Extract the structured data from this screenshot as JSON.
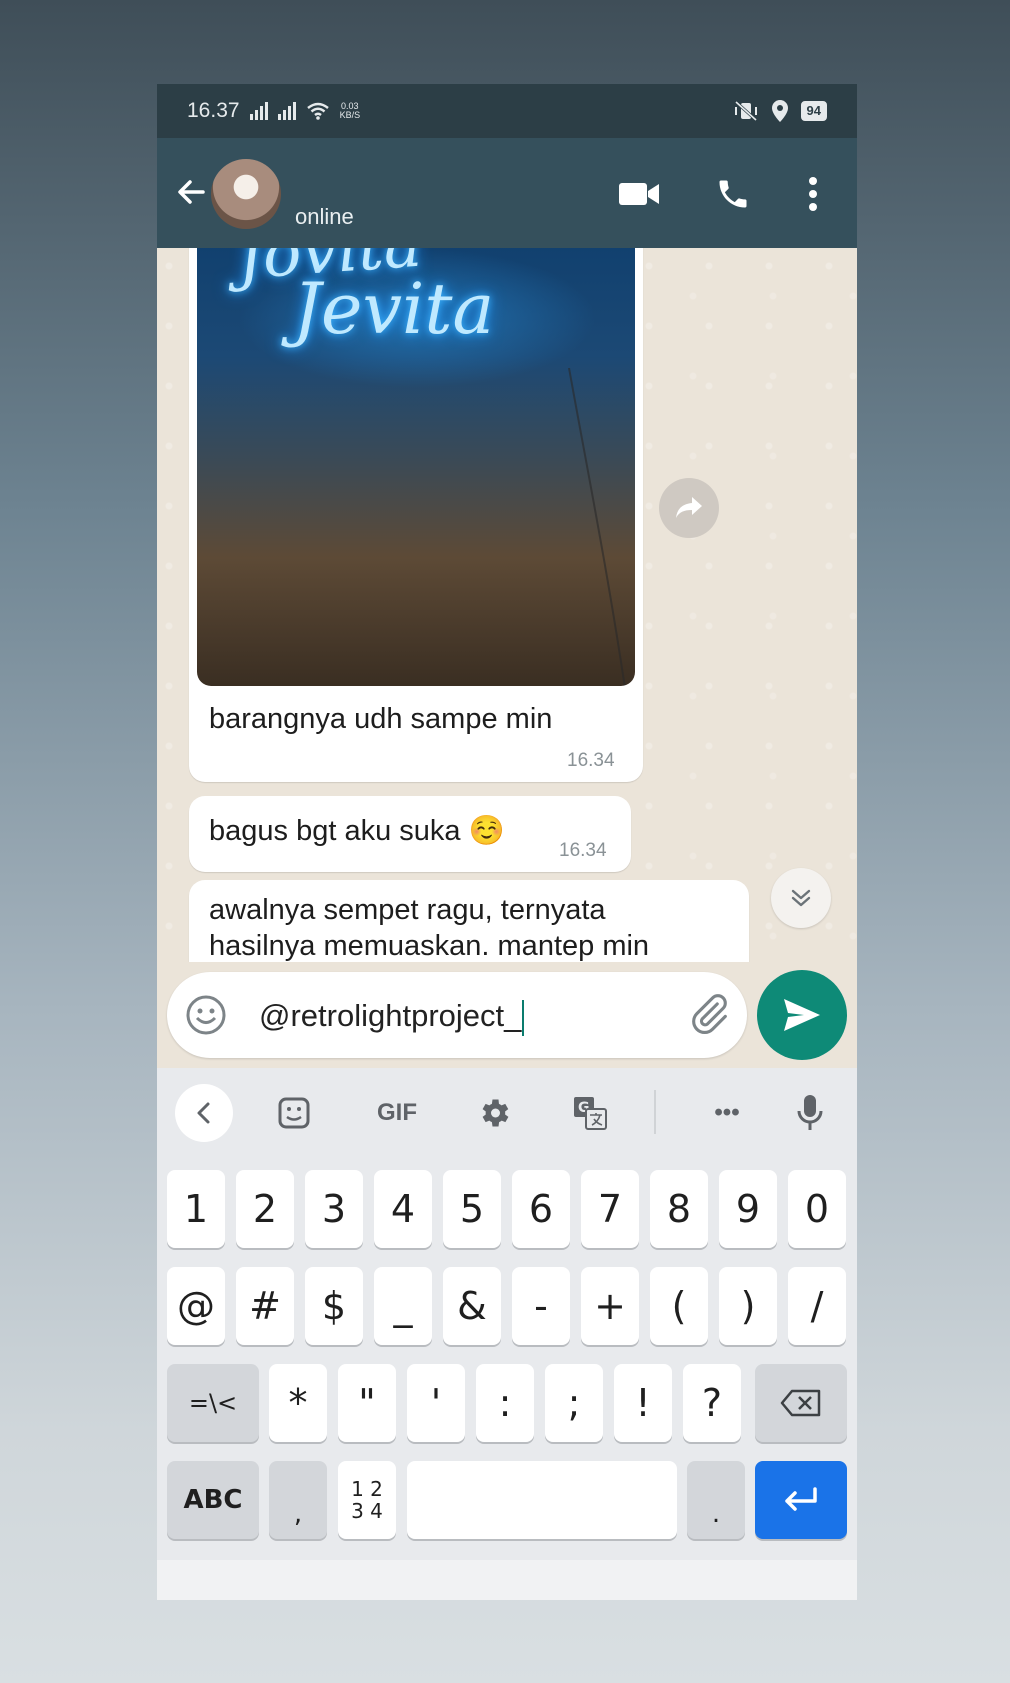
{
  "status_bar": {
    "time": "16.37",
    "net_speed_value": "0.03",
    "net_speed_unit": "KB/S",
    "battery": "94"
  },
  "header": {
    "contact_status": "online"
  },
  "photo_sign": {
    "line1": "Jovita",
    "line2": "Jevita"
  },
  "messages": [
    {
      "text": "barangnya udh sampe min",
      "time": "16.34"
    },
    {
      "text": "bagus bgt aku suka ☺️",
      "time": "16.34"
    },
    {
      "text_line1": "awalnya sempet ragu, ternyata",
      "text_line2": "hasilnya memuaskan. mantep min"
    }
  ],
  "input": {
    "value": "@retrolightproject_"
  },
  "keyboard": {
    "toolbar": {
      "gif": "GIF",
      "more": "•••"
    },
    "row1": [
      "1",
      "2",
      "3",
      "4",
      "5",
      "6",
      "7",
      "8",
      "9",
      "0"
    ],
    "row2": [
      "@",
      "#",
      "$",
      "_",
      "&",
      "-",
      "+",
      "(",
      ")",
      "/"
    ],
    "row3": [
      "=\\<",
      "*",
      "\"",
      "'",
      ":",
      ";",
      "!",
      "?"
    ],
    "row4": {
      "abc": "ABC",
      "comma": ",",
      "numpad": "1 2\n3 4",
      "period": "."
    }
  },
  "colors": {
    "header": "#35505c",
    "send_button": "#0e8a77",
    "enter_key": "#1a73e8"
  },
  "icons": {
    "header": [
      "back-arrow-icon",
      "video-call-icon",
      "voice-call-icon",
      "more-options-icon"
    ],
    "input": [
      "emoji-icon",
      "attach-icon",
      "send-icon"
    ],
    "keyboard_toolbar": [
      "chevron-left-icon",
      "sticker-icon",
      "gif-icon",
      "settings-icon",
      "translate-icon",
      "more-icon",
      "mic-icon"
    ]
  }
}
